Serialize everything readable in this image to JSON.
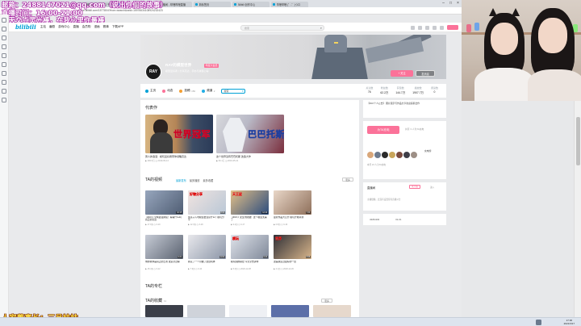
{
  "browser": {
    "tabs": [
      {
        "title": "哔哩哔哩 (゜-゜)つロ 干杯~-bili",
        "active": false
      },
      {
        "title": "RAY的模型世界个人空间",
        "active": true
      },
      {
        "title": "直播间 - 哔哩哔哩直播",
        "active": false
      },
      {
        "title": "新标签页",
        "active": false
      },
      {
        "title": "Bilibili 创作中心",
        "active": false
      },
      {
        "title": "哔哩哔哩 (゜-゜)つロ",
        "active": false
      }
    ],
    "url": "space.bilibili.com/1577804?from=search&seid=15976634108924232423"
  },
  "overlay": {
    "line1": "邮箱：2488147021@qq.com（说出你们的故事）",
    "line2": "直播时间：16:00-21:00",
    "line3": "每天交点灵光棒，在我心里你最棒",
    "bottom": "人家董事长：三月妹妹"
  },
  "sitenav": {
    "logo": "bilibili",
    "links": [
      "主站",
      "番剧",
      "游戏中心",
      "直播",
      "会员购",
      "漫画",
      "赛事",
      "下载APP"
    ],
    "search_placeholder": "搜索"
  },
  "profile": {
    "avatar_text": "RAY",
    "name": "RAY的模型世界",
    "level": "年度大会员",
    "sign": "模型爱好者 | 分享高达、手办与拼装心得",
    "follow_label": "+ 关注",
    "message_label": "发消息"
  },
  "ptabs": [
    {
      "label": "主页",
      "count": "",
      "color": "#00a1d6"
    },
    {
      "label": "动态",
      "count": "",
      "color": "#fb7299"
    },
    {
      "label": "投稿",
      "count": "150",
      "color": "#f3a034"
    },
    {
      "label": "频道",
      "count": "2",
      "color": "#23ade5"
    }
  ],
  "psearch_value": "搜索",
  "stats": [
    {
      "label": "关注数",
      "value": "76"
    },
    {
      "label": "粉丝数",
      "value": "62.2万"
    },
    {
      "label": "获赞数",
      "value": "144.7万"
    },
    {
      "label": "播放数",
      "value": "1907.7万"
    },
    {
      "label": "阅读数",
      "value": "0"
    }
  ],
  "representative": {
    "title": "代表作",
    "works": [
      {
        "title": "男人的浪漫：模玩爱好者带你领略高达",
        "meta": "▶ 200.8万  ◷ 2019-09-14",
        "caption": "世界冠军"
      },
      {
        "title": "这个世界没有巴巴托斯 改造大作",
        "meta": "▶ 63.1万  ◷ 2019-05-21",
        "caption": "巴巴托斯"
      }
    ]
  },
  "videos": {
    "title": "TA的视频",
    "tabs": [
      "最新发布",
      "最多播放",
      "最多收藏"
    ],
    "more_label": "更多",
    "items": [
      {
        "title": "【RAY】全网最强拼装！看看什么叫真正的高达",
        "meta": "▶ 17.9万  ◷ 3-19",
        "duration": "10:15",
        "caption": ""
      },
      {
        "title": "女孩子入坑模型要注意什么？模玩分享",
        "meta": "▶ 12.3万  ◷ 3-18",
        "duration": "8:02",
        "caption": "好物分享"
      },
      {
        "title": "【RAY】女生也能做！这个模型太美了",
        "meta": "▶ 9.2万  ◷ 3-17",
        "duration": "12:40",
        "caption": "天王星"
      },
      {
        "title": "最新作品大公开 模玩开箱评测",
        "meta": "▶ 6.8万  ◷ 3-16",
        "duration": "7:33",
        "caption": ""
      },
      {
        "title": "他的机体是真正的王者 改造全过程",
        "meta": "▶ 15.4万  ◷ 3-12",
        "duration": "9:21",
        "caption": ""
      },
      {
        "title": "我花了一个月做了这台机体",
        "meta": "▶ 7.9万  ◷ 3-10",
        "duration": "11:02",
        "caption": ""
      },
      {
        "title": "模玩圈的秘密 今天全告诉你",
        "meta": "▶ 5.6万  ◷ 2020-12-28",
        "duration": "6:44",
        "caption": "模玩"
      },
      {
        "title": "这是我见过最好的一台",
        "meta": "▶ 4.1万  ◷ 2020-12-20",
        "duration": "8:58",
        "caption": "世界"
      }
    ]
  },
  "column": {
    "title": "TA的专栏"
  },
  "favorites": {
    "title": "TA的收藏",
    "count": "11"
  },
  "right": {
    "notice": "【RAY个人公告】 图片展示与作品分享欢迎投稿合作",
    "charge_button": "为TA充电",
    "charge_note": "共有 3 人为TA充电",
    "charge_rank": "充电榜",
    "charge_foot": "本月 23 人为TA充电",
    "announce_title": "直播间",
    "announce_tag": "未开播",
    "announce_tag2": "进入",
    "announce_body": "主播很懒，还没有设置任何直播公告",
    "uid": "43291102",
    "birthday": "01-01"
  },
  "taskbar": {
    "time": "17:36",
    "date": "2021/3/17"
  }
}
